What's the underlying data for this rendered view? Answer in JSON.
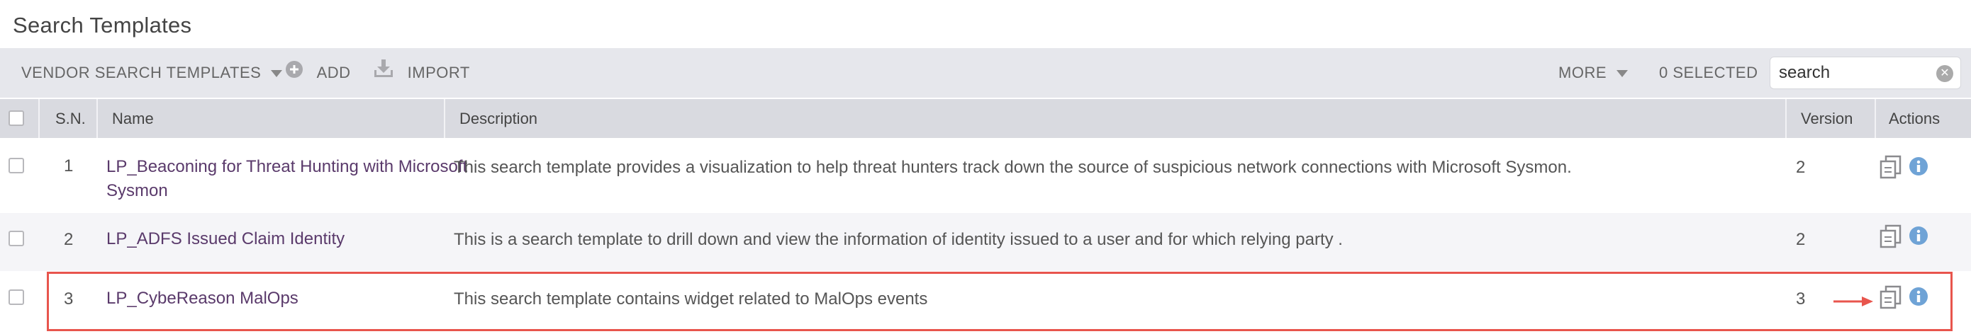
{
  "page": {
    "title": "Search Templates"
  },
  "toolbar": {
    "vendor_label": "VENDOR SEARCH TEMPLATES",
    "add_label": "ADD",
    "import_label": "IMPORT",
    "more_label": "MORE",
    "selected_label": "0 SELECTED",
    "search_value": "search"
  },
  "table": {
    "columns": [
      "S.N.",
      "Name",
      "Description",
      "Version",
      "Actions"
    ],
    "rows": [
      {
        "sn": "1",
        "name": "LP_Beaconing for Threat Hunting with Microsoft Sysmon",
        "description": "This search template provides a visualization to help threat hunters track down the source of suspicious network connections with Microsoft Sysmon.",
        "version": "2"
      },
      {
        "sn": "2",
        "name": "LP_ADFS Issued Claim Identity",
        "description": "This is a search template to drill down and view the information of identity issued to a user and for which relying party .",
        "version": "2"
      },
      {
        "sn": "3",
        "name": "LP_CybeReason MalOps",
        "description": "This search template contains widget related to MalOps events",
        "version": "3"
      }
    ]
  },
  "colors": {
    "toolbar_bg": "#e6e7ec",
    "header_bg": "#d9dae0",
    "name_link": "#5a3a6b",
    "info_icon": "#6fa3d6",
    "highlight": "#e8554d"
  }
}
